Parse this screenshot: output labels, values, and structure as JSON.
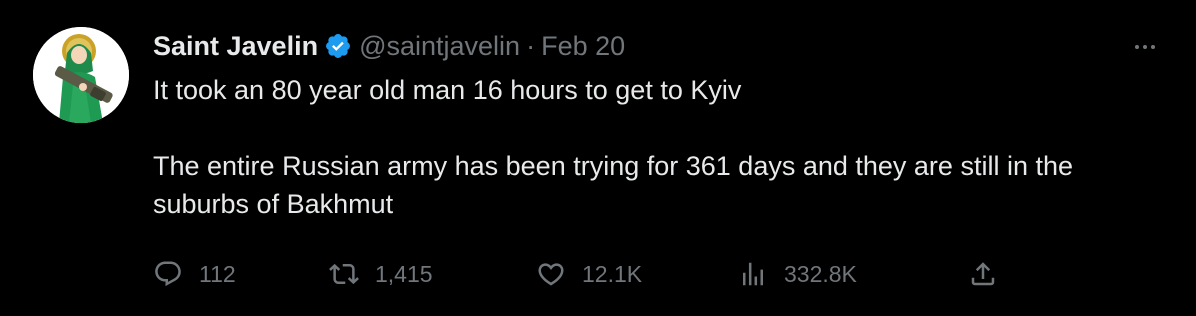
{
  "tweet": {
    "display_name": "Saint Javelin",
    "handle": "@saintjavelin",
    "separator": "·",
    "date": "Feb 20",
    "text_line_1": "It took an 80 year old man 16 hours to get to Kyiv",
    "text_line_2": "The entire Russian army has been trying for 361 days and they are still in the suburbs of Bakhmut"
  },
  "actions": {
    "replies": "112",
    "retweets": "1,415",
    "likes": "12.1K",
    "views": "332.8K"
  },
  "icons": {
    "verified": "verified-badge-icon",
    "more": "more-horizontal-icon",
    "reply": "reply-icon",
    "retweet": "retweet-icon",
    "like": "heart-icon",
    "views": "views-chart-icon",
    "share": "share-icon"
  },
  "colors": {
    "background": "#000000",
    "text": "#e7e9ea",
    "muted": "#71767b",
    "verified": "#1d9bf0"
  }
}
